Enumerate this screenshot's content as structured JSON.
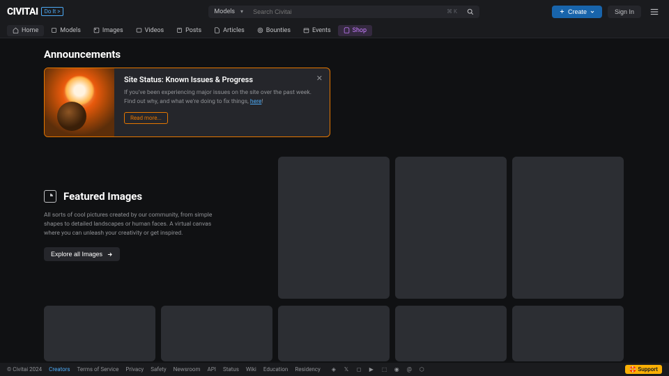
{
  "header": {
    "logo_text": "CIVITAI",
    "logo_badge": "Do It >",
    "search_select": "Models",
    "search_placeholder": "Search Civitai",
    "search_kbd": "⌘ K",
    "create_label": "Create",
    "signin_label": "Sign In"
  },
  "nav": {
    "home": "Home",
    "models": "Models",
    "images": "Images",
    "videos": "Videos",
    "posts": "Posts",
    "articles": "Articles",
    "bounties": "Bounties",
    "events": "Events",
    "shop": "Shop"
  },
  "announcements": {
    "heading": "Announcements",
    "title": "Site Status: Known Issues & Progress",
    "desc_a": "If you've been experiencing major issues on the site over the past week. Find out why, and what we're doing to fix things, ",
    "desc_link": "here",
    "desc_b": "!",
    "read_more": "Read more..."
  },
  "featured": {
    "title": "Featured Images",
    "desc": "All sorts of cool pictures created by our community, from simple shapes to detailed landscapes or human faces. A virtual canvas where you can unleash your creativity or get inspired.",
    "explore": "Explore all Images"
  },
  "footer": {
    "copyright": "© Civitai 2024",
    "creators": "Creators",
    "tos": "Terms of Service",
    "privacy": "Privacy",
    "safety": "Safety",
    "newsroom": "Newsroom",
    "api": "API",
    "status": "Status",
    "wiki": "Wiki",
    "education": "Education",
    "residency": "Residency",
    "support": "🛟 Support"
  }
}
